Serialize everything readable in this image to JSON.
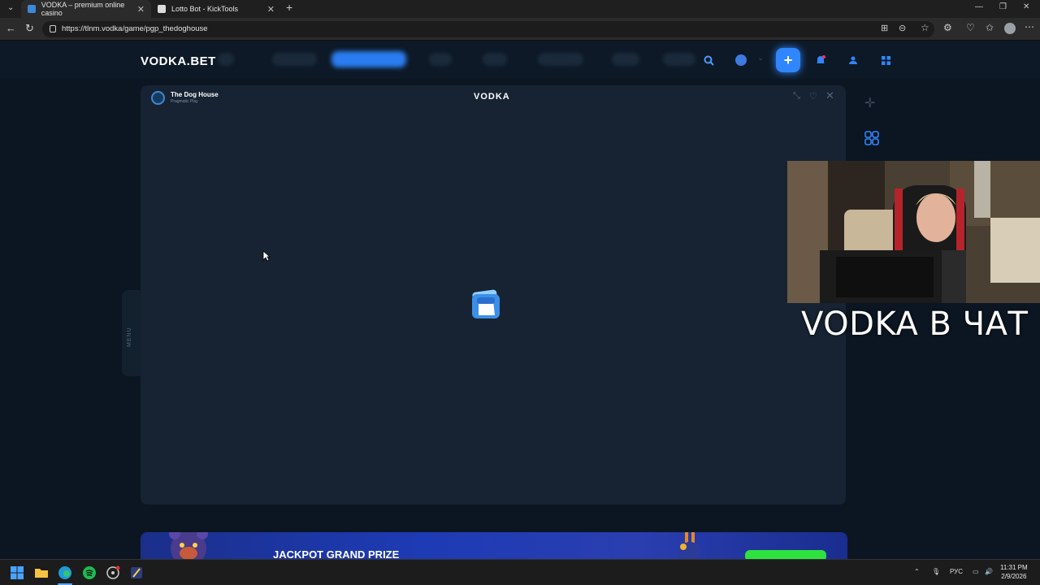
{
  "browser": {
    "tabs": [
      {
        "title": "VODKA – premium online casino",
        "active": true
      },
      {
        "title": "Lotto Bot - KickTools",
        "active": false
      }
    ],
    "url": "https://tlnm.vodka/game/pgp_thedoghouse"
  },
  "site": {
    "logo": "VODKA.BET",
    "game_title": "The Dog House",
    "game_provider": "Pragmatic Play",
    "center_logo": "VODKA",
    "menu_label": "MENU",
    "banner_title": "JACKPOT GRAND PRIZE"
  },
  "stream": {
    "overlay_text": "VODKA В ЧАТ"
  },
  "taskbar": {
    "lang": "РУС",
    "time": "11:31 PM",
    "date": "2/9/2026"
  },
  "colors": {
    "accent": "#2f86ff",
    "page_bg": "#0b1622",
    "panel_bg": "#172332",
    "jackpot_green": "#2fe23f"
  }
}
